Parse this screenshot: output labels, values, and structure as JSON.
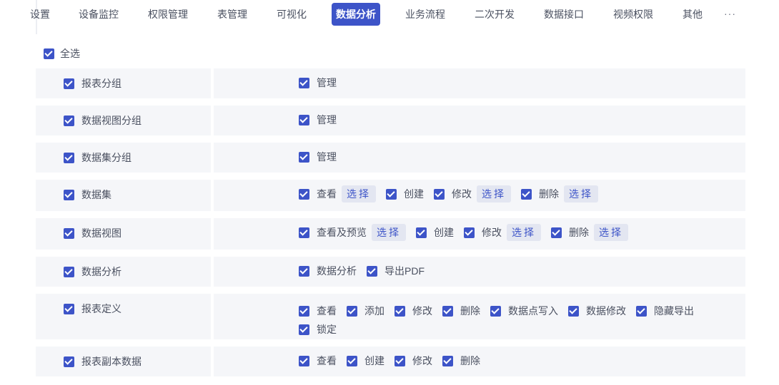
{
  "tabs": [
    {
      "label": "设置",
      "active": false
    },
    {
      "label": "设备监控",
      "active": false
    },
    {
      "label": "权限管理",
      "active": false
    },
    {
      "label": "表管理",
      "active": false
    },
    {
      "label": "可视化",
      "active": false
    },
    {
      "label": "数据分析",
      "active": true
    },
    {
      "label": "业务流程",
      "active": false
    },
    {
      "label": "二次开发",
      "active": false
    },
    {
      "label": "数据接口",
      "active": false
    },
    {
      "label": "视频权限",
      "active": false
    },
    {
      "label": "其他",
      "active": false
    }
  ],
  "more_label": "···",
  "select_all_label": "全选",
  "select_all_checked": true,
  "select_button_label": "选择",
  "groups": [
    {
      "name": "报表分组",
      "checked": true,
      "options": [
        {
          "label": "管理",
          "checked": true,
          "has_select": false
        }
      ]
    },
    {
      "name": "数据视图分组",
      "checked": true,
      "options": [
        {
          "label": "管理",
          "checked": true,
          "has_select": false
        }
      ]
    },
    {
      "name": "数据集分组",
      "checked": true,
      "options": [
        {
          "label": "管理",
          "checked": true,
          "has_select": false
        }
      ]
    },
    {
      "name": "数据集",
      "checked": true,
      "options": [
        {
          "label": "查看",
          "checked": true,
          "has_select": true
        },
        {
          "label": "创建",
          "checked": true,
          "has_select": false
        },
        {
          "label": "修改",
          "checked": true,
          "has_select": true
        },
        {
          "label": "删除",
          "checked": true,
          "has_select": true
        }
      ]
    },
    {
      "name": "数据视图",
      "checked": true,
      "options": [
        {
          "label": "查看及预览",
          "checked": true,
          "has_select": true
        },
        {
          "label": "创建",
          "checked": true,
          "has_select": false
        },
        {
          "label": "修改",
          "checked": true,
          "has_select": true
        },
        {
          "label": "删除",
          "checked": true,
          "has_select": true
        }
      ]
    },
    {
      "name": "数据分析",
      "checked": true,
      "options": [
        {
          "label": "数据分析",
          "checked": true,
          "has_select": false
        },
        {
          "label": "导出PDF",
          "checked": true,
          "has_select": false
        }
      ]
    },
    {
      "name": "报表定义",
      "checked": true,
      "options": [
        {
          "label": "查看",
          "checked": true,
          "has_select": false
        },
        {
          "label": "添加",
          "checked": true,
          "has_select": false
        },
        {
          "label": "修改",
          "checked": true,
          "has_select": false
        },
        {
          "label": "删除",
          "checked": true,
          "has_select": false
        },
        {
          "label": "数据点写入",
          "checked": true,
          "has_select": false
        },
        {
          "label": "数据修改",
          "checked": true,
          "has_select": false
        },
        {
          "label": "隐藏导出",
          "checked": true,
          "has_select": false
        },
        {
          "label": "锁定",
          "checked": true,
          "has_select": false
        }
      ]
    },
    {
      "name": "报表副本数据",
      "checked": true,
      "options": [
        {
          "label": "查看",
          "checked": true,
          "has_select": false
        },
        {
          "label": "创建",
          "checked": true,
          "has_select": false
        },
        {
          "label": "修改",
          "checked": true,
          "has_select": false
        },
        {
          "label": "删除",
          "checked": true,
          "has_select": false
        }
      ]
    }
  ],
  "colors": {
    "accent": "#3d54c8",
    "row_bg": "#f5f6f9",
    "select_bg": "#e3e6f1"
  }
}
